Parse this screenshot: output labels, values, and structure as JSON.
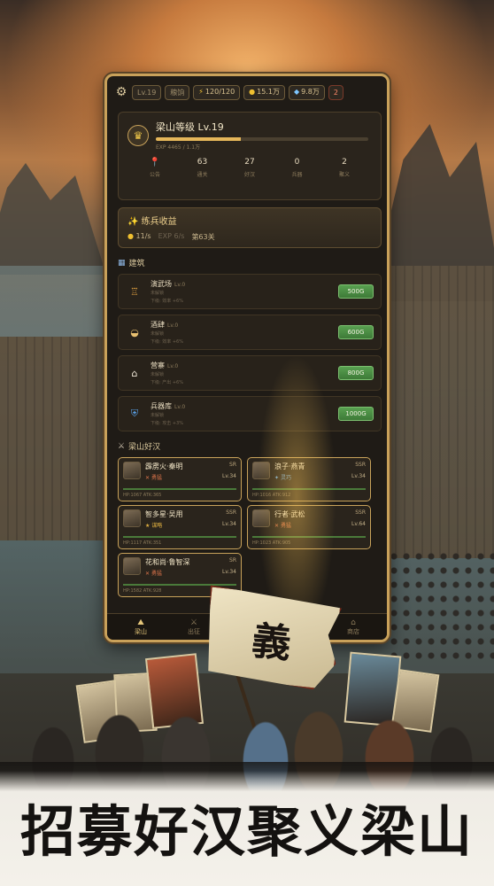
{
  "topbar": {
    "level_pill": "Lv.19",
    "second_pill": "粮饷",
    "energy": "120/120",
    "gold": "15.1万",
    "gems": "9.8万",
    "red_badge": "2"
  },
  "status": {
    "title": "梁山等级 Lv.19",
    "exp_text": "EXP 4465 / 1.1万",
    "exp_progress": 0.4,
    "stats": [
      {
        "label": "公告",
        "value": ""
      },
      {
        "label": "通关",
        "value": "63"
      },
      {
        "label": "好汉",
        "value": "27"
      },
      {
        "label": "兵器",
        "value": "0"
      },
      {
        "label": "聚义",
        "value": "2"
      }
    ]
  },
  "training": {
    "title": "练兵收益",
    "rate": "11/s",
    "exp": "EXP 6/s",
    "stage": "第63关"
  },
  "buildings_section": "建筑",
  "buildings": [
    {
      "name": "演武场",
      "lv": "Lv.0",
      "sub1": "未解锁",
      "sub2": "下级: 效率 +6%",
      "cost": "500G",
      "icon": "trophy-icon"
    },
    {
      "name": "酒肆",
      "lv": "Lv.0",
      "sub1": "未解锁",
      "sub2": "下级: 效率 +6%",
      "cost": "600G",
      "icon": "bowl-icon"
    },
    {
      "name": "营寨",
      "lv": "Lv.0",
      "sub1": "未解锁",
      "sub2": "下级: 产出 +6%",
      "cost": "800G",
      "icon": "house-icon"
    },
    {
      "name": "兵器库",
      "lv": "Lv.0",
      "sub1": "未解锁",
      "sub2": "下级: 攻击 +3%",
      "cost": "1000G",
      "icon": "shield-icon"
    }
  ],
  "heroes_section": "梁山好汉",
  "heroes": [
    {
      "name": "霹雳火·秦明",
      "rarity": "SR",
      "tag": "勇猛",
      "level": "Lv.34",
      "stats": "HP:1067 ATK:365"
    },
    {
      "name": "浪子·燕青",
      "rarity": "SSR",
      "tag": "灵巧",
      "level": "Lv.34",
      "stats": "HP:1016 ATK:912"
    },
    {
      "name": "智多星·吴用",
      "rarity": "SSR",
      "tag": "谋略",
      "level": "Lv.34",
      "stats": "HP:1117 ATK:351"
    },
    {
      "name": "行者·武松",
      "rarity": "SSR",
      "tag": "勇猛",
      "level": "Lv.64",
      "stats": "HP:1023 ATK:905"
    },
    {
      "name": "花和尚·鲁智深",
      "rarity": "SR",
      "tag": "勇猛",
      "level": "Lv.34",
      "stats": "HP:1582 ATK:928"
    }
  ],
  "nav": [
    {
      "label": "梁山",
      "icon": "mountain-icon"
    },
    {
      "label": "出征",
      "icon": "sword-icon"
    },
    {
      "label": "好汉",
      "icon": "person-icon"
    },
    {
      "label": "聚义",
      "icon": "flag-icon"
    },
    {
      "label": "商店",
      "icon": "shop-icon"
    }
  ],
  "banner_char": "義",
  "slogan": "招募好汉聚义梁山"
}
